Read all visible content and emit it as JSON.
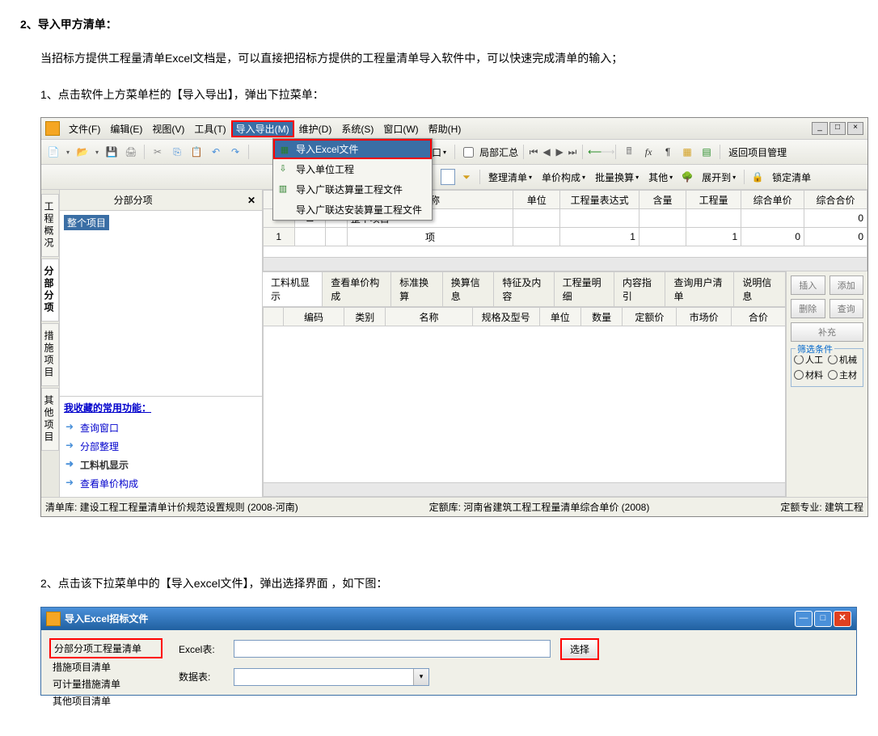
{
  "doc": {
    "heading": "2、导入甲方清单：",
    "paragraph": "当招标方提供工程量清单Excel文档是，可以直接把招标方提供的工程量清单导入软件中，可以快速完成清单的输入；",
    "step1": "1、点击软件上方菜单栏的【导入导出】，弹出下拉菜单：",
    "step2": "2、点击该下拉菜单中的【导入excel文件】，弹出选择界面 ，如下图："
  },
  "app": {
    "menu": {
      "file": "文件(F)",
      "edit": "编辑(E)",
      "view": "视图(V)",
      "tools": "工具(T)",
      "import_export": "导入导出(M)",
      "maintain": "维护(D)",
      "system": "系统(S)",
      "window": "窗口(W)",
      "help": "帮助(H)"
    },
    "dropdown": {
      "item1": "导入Excel文件",
      "item2": "导入单位工程",
      "item3": "导入广联达算量工程文件",
      "item4": "导入广联达安装算量工程文件"
    },
    "toolbar2": {
      "window_btn": "窗口",
      "local_summary": "局部汇总",
      "return_mgmt": "返回项目管理"
    },
    "toolbar3": {
      "organize_list": "整理清单",
      "unit_price_composition": "单价构成",
      "batch_convert": "批量换算",
      "other": "其他",
      "expand_to": "展开到",
      "lock_list": "锁定清单"
    },
    "sidebar": {
      "title": "分部分项",
      "tree_root": "整个项目",
      "tab1": "工程概况",
      "tab2": "分部分项",
      "tab3": "措施项目",
      "tab4": "其他项目",
      "fav_header": "我收藏的常用功能：",
      "fav1": "查询窗口",
      "fav2": "分部整理",
      "fav3": "工料机显示",
      "fav4": "查看单价构成"
    },
    "grid": {
      "col_name": "名称",
      "col_unit": "单位",
      "col_expr": "工程量表达式",
      "col_qty_含": "含量",
      "col_qty": "工程量",
      "col_unit_price": "综合单价",
      "col_total": "综合合价",
      "row0_name": "整个项目",
      "row0_total": "0",
      "row1_idx": "1",
      "row1_type": "项",
      "row1_expr": "1",
      "row1_qty": "1",
      "row1_up": "0",
      "row1_total": "0"
    },
    "subtabs": {
      "t1": "工料机显示",
      "t2": "查看单价构成",
      "t3": "标准换算",
      "t4": "换算信息",
      "t5": "特征及内容",
      "t6": "工程量明细",
      "t7": "内容指引",
      "t8": "查询用户清单",
      "t9": "说明信息",
      "c1": "编码",
      "c2": "类别",
      "c3": "名称",
      "c4": "规格及型号",
      "c5": "单位",
      "c6": "数量",
      "c7": "定额价",
      "c8": "市场价",
      "c9": "合价"
    },
    "actions": {
      "insert": "插入",
      "add": "添加",
      "delete": "删除",
      "query": "查询",
      "supplement": "补充",
      "filter_title": "筛选条件",
      "labor": "人工",
      "machine": "机械",
      "material": "材料",
      "main_mat": "主材"
    },
    "status": {
      "list_lib": "清单库: 建设工程工程量清单计价规范设置规则 (2008-河南)",
      "quota_lib": "定额库: 河南省建筑工程工程量清单综合单价 (2008)",
      "quota_major": "定额专业: 建筑工程"
    }
  },
  "dialog": {
    "title": "导入Excel招标文件",
    "list1": "分部分项工程量清单",
    "list2": "措施项目清单",
    "list3": "可计量措施清单",
    "list4": "其他项目清单",
    "label_excel": "Excel表:",
    "label_data": "数据表:",
    "select_btn": "选择"
  }
}
